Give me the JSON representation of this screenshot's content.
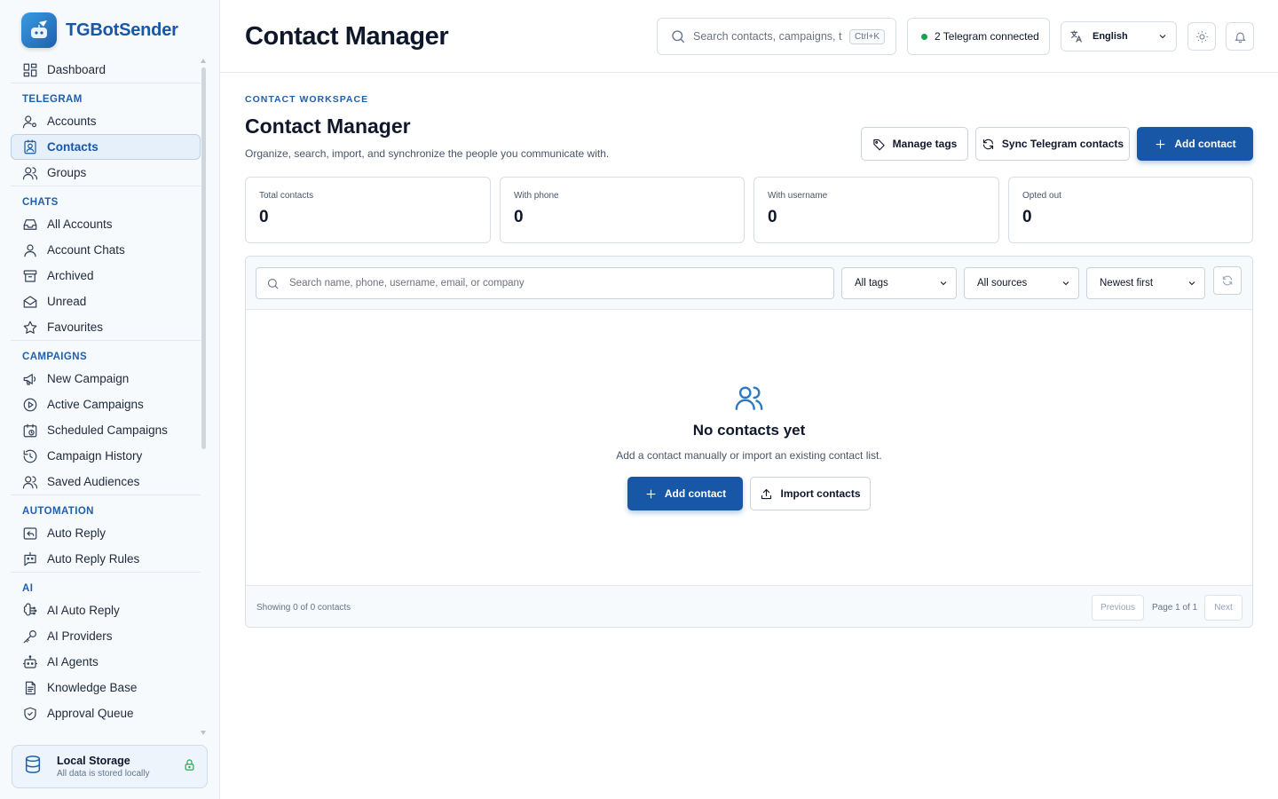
{
  "app": {
    "name": "TGBotSender"
  },
  "sidebar": {
    "dashboard": "Dashboard",
    "sections": {
      "telegram": "TELEGRAM",
      "chats": "CHATS",
      "campaigns": "CAMPAIGNS",
      "automation": "AUTOMATION",
      "ai": "AI"
    },
    "items": {
      "accounts": "Accounts",
      "contacts": "Contacts",
      "groups": "Groups",
      "all_accounts": "All Accounts",
      "account_chats": "Account Chats",
      "archived": "Archived",
      "unread": "Unread",
      "favourites": "Favourites",
      "new_campaign": "New Campaign",
      "active_campaigns": "Active Campaigns",
      "scheduled_campaigns": "Scheduled Campaigns",
      "campaign_history": "Campaign History",
      "saved_audiences": "Saved Audiences",
      "auto_reply": "Auto Reply",
      "auto_reply_rules": "Auto Reply Rules",
      "ai_auto_reply": "AI Auto Reply",
      "ai_providers": "AI Providers",
      "ai_agents": "AI Agents",
      "knowledge_base": "Knowledge Base",
      "approval_queue": "Approval Queue"
    },
    "active_item": "contacts",
    "storage": {
      "title": "Local Storage",
      "subtitle": "All data is stored locally"
    }
  },
  "header": {
    "title": "Contact Manager",
    "search_placeholder": "Search contacts, campaigns, t...",
    "shortcut": "Ctrl+K",
    "telegram_status": "2 Telegram connected",
    "language": "English"
  },
  "main": {
    "eyebrow": "CONTACT WORKSPACE",
    "title": "Contact Manager",
    "description": "Organize, search, import, and synchronize the people you communicate with.",
    "buttons": {
      "manage_tags": "Manage tags",
      "sync_contacts": "Sync Telegram contacts",
      "add_contact": "Add contact"
    },
    "stats": [
      {
        "label": "Total contacts",
        "value": "0"
      },
      {
        "label": "With phone",
        "value": "0"
      },
      {
        "label": "With username",
        "value": "0"
      },
      {
        "label": "Opted out",
        "value": "0"
      }
    ],
    "filters": {
      "search_placeholder": "Search name, phone, username, email, or company",
      "tags": "All tags",
      "sources": "All sources",
      "sort": "Newest first"
    },
    "empty_state": {
      "title": "No contacts yet",
      "description": "Add a contact manually or import an existing contact list.",
      "add_button": "Add contact",
      "import_button": "Import contacts"
    },
    "footer": {
      "showing": "Showing 0 of 0 contacts",
      "previous": "Previous",
      "page": "Page 1 of 1",
      "next": "Next"
    }
  },
  "colors": {
    "brand": "#1757a6",
    "accent_light": "#e6f0fb",
    "status_green": "#16a34a"
  }
}
